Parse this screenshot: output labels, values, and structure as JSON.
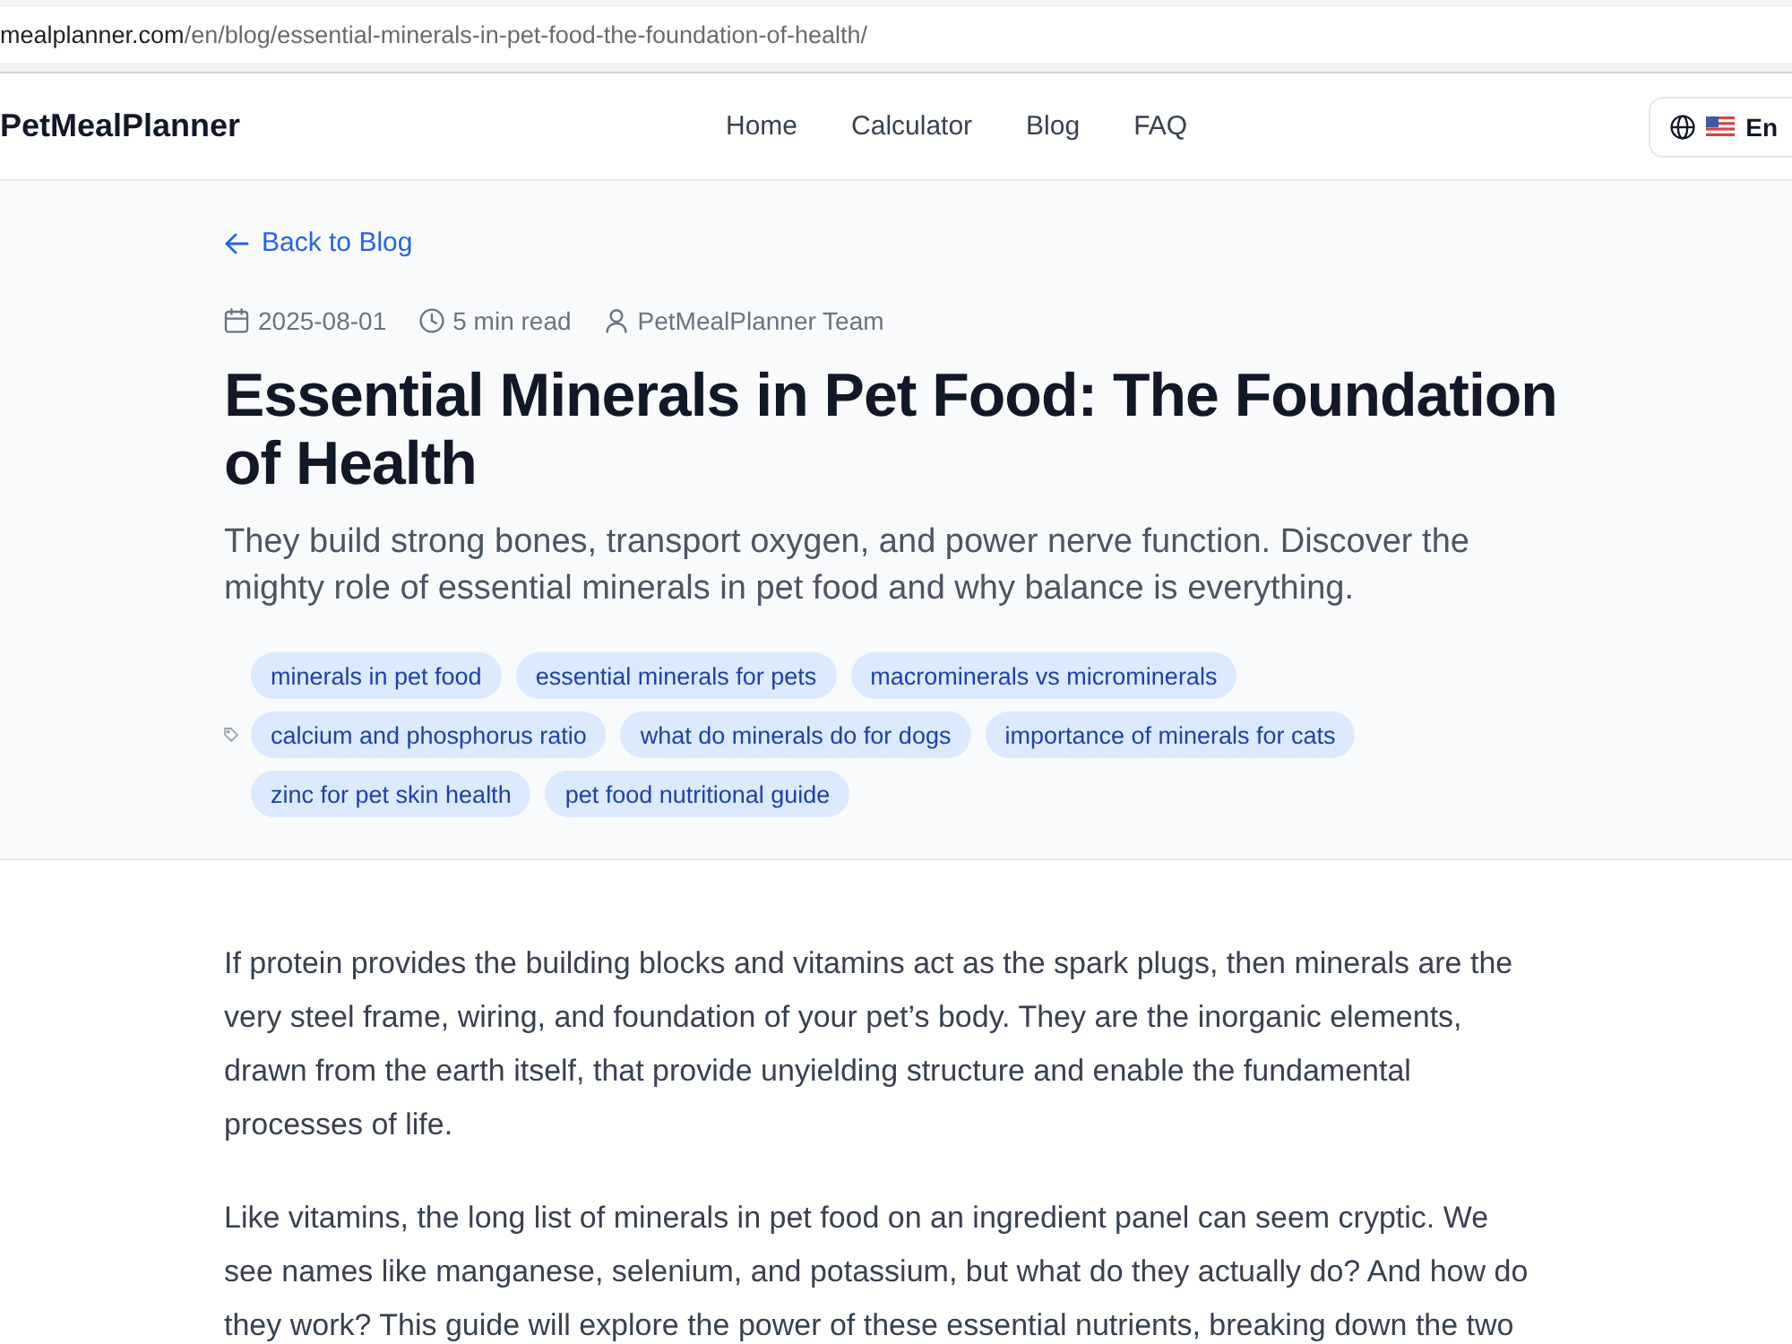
{
  "browser": {
    "url_host": "mealplanner.com",
    "url_path": "/en/blog/essential-minerals-in-pet-food-the-foundation-of-health/"
  },
  "header": {
    "logo": "PetMealPlanner",
    "nav": [
      "Home",
      "Calculator",
      "Blog",
      "FAQ"
    ],
    "language": "En"
  },
  "hero": {
    "back_link": "Back to Blog",
    "meta": {
      "date": "2025-08-01",
      "read_time": "5 min read",
      "author": "PetMealPlanner Team"
    },
    "title": "Essential Minerals in Pet Food: The Foundation of Health",
    "subtitle": "They build strong bones, transport oxygen, and power nerve function. Discover the mighty role of essential minerals in pet food and why balance is everything.",
    "tags": [
      "minerals in pet food",
      "essential minerals for pets",
      "macrominerals vs microminerals",
      "calcium and phosphorus ratio",
      "what do minerals do for dogs",
      "importance of minerals for cats",
      "zinc for pet skin health",
      "pet food nutritional guide"
    ]
  },
  "article": {
    "paragraphs": [
      "If protein provides the building blocks and vitamins act as the spark plugs, then minerals are the very steel frame, wiring, and foundation of your pet’s body. They are the inorganic elements, drawn from the earth itself, that provide unyielding structure and enable the fundamental processes of life.",
      "Like vitamins, the long list of minerals in pet food on an ingredient panel can seem cryptic. We see names like manganese, selenium, and potassium, but what do they actually do? And how do they work? This guide will explore the power of these essential nutrients, breaking down the two"
    ]
  }
}
